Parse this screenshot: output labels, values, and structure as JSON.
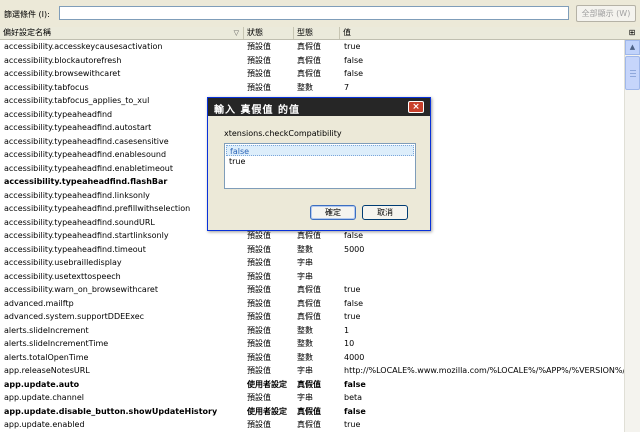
{
  "filter": {
    "label": "篩選條件 (I):",
    "value": "",
    "placeholder": "",
    "show_all_label": "全部顯示 (W)"
  },
  "columns": {
    "name": "偏好設定名稱",
    "status": "狀態",
    "type": "型態",
    "value": "值"
  },
  "rows": [
    {
      "name": "accessibility.accesskeycausesactivation",
      "status": "預設值",
      "type": "真假值",
      "value": "true",
      "bold": false
    },
    {
      "name": "accessibility.blockautorefresh",
      "status": "預設值",
      "type": "真假值",
      "value": "false",
      "bold": false
    },
    {
      "name": "accessibility.browsewithcaret",
      "status": "預設值",
      "type": "真假值",
      "value": "false",
      "bold": false
    },
    {
      "name": "accessibility.tabfocus",
      "status": "預設值",
      "type": "整數",
      "value": "7",
      "bold": false
    },
    {
      "name": "accessibility.tabfocus_applies_to_xul",
      "status": "",
      "type": "",
      "value": "",
      "bold": false
    },
    {
      "name": "accessibility.typeaheadfind",
      "status": "",
      "type": "",
      "value": "",
      "bold": false
    },
    {
      "name": "accessibility.typeaheadfind.autostart",
      "status": "",
      "type": "",
      "value": "",
      "bold": false
    },
    {
      "name": "accessibility.typeaheadfind.casesensitive",
      "status": "",
      "type": "",
      "value": "",
      "bold": false
    },
    {
      "name": "accessibility.typeaheadfind.enablesound",
      "status": "",
      "type": "",
      "value": "",
      "bold": false
    },
    {
      "name": "accessibility.typeaheadfind.enabletimeout",
      "status": "",
      "type": "",
      "value": "",
      "bold": false
    },
    {
      "name": "accessibility.typeaheadfind.flashBar",
      "status": "",
      "type": "",
      "value": "",
      "bold": true
    },
    {
      "name": "accessibility.typeaheadfind.linksonly",
      "status": "",
      "type": "",
      "value": "",
      "bold": false
    },
    {
      "name": "accessibility.typeaheadfind.prefillwithselection",
      "status": "",
      "type": "",
      "value": "",
      "bold": false
    },
    {
      "name": "accessibility.typeaheadfind.soundURL",
      "status": "",
      "type": "",
      "value": "",
      "bold": false
    },
    {
      "name": "accessibility.typeaheadfind.startlinksonly",
      "status": "預設值",
      "type": "真假值",
      "value": "false",
      "bold": false
    },
    {
      "name": "accessibility.typeaheadfind.timeout",
      "status": "預設值",
      "type": "整數",
      "value": "5000",
      "bold": false
    },
    {
      "name": "accessibility.usebrailledisplay",
      "status": "預設值",
      "type": "字串",
      "value": "",
      "bold": false
    },
    {
      "name": "accessibility.usetexttospeech",
      "status": "預設值",
      "type": "字串",
      "value": "",
      "bold": false
    },
    {
      "name": "accessibility.warn_on_browsewithcaret",
      "status": "預設值",
      "type": "真假值",
      "value": "true",
      "bold": false
    },
    {
      "name": "advanced.mailftp",
      "status": "預設值",
      "type": "真假值",
      "value": "false",
      "bold": false
    },
    {
      "name": "advanced.system.supportDDEExec",
      "status": "預設值",
      "type": "真假值",
      "value": "true",
      "bold": false
    },
    {
      "name": "alerts.slideIncrement",
      "status": "預設值",
      "type": "整數",
      "value": "1",
      "bold": false
    },
    {
      "name": "alerts.slideIncrementTime",
      "status": "預設值",
      "type": "整數",
      "value": "10",
      "bold": false
    },
    {
      "name": "alerts.totalOpenTime",
      "status": "預設值",
      "type": "整數",
      "value": "4000",
      "bold": false
    },
    {
      "name": "app.releaseNotesURL",
      "status": "預設值",
      "type": "字串",
      "value": "http://%LOCALE%.www.mozilla.com/%LOCALE%/%APP%/%VERSION%/...",
      "bold": false
    },
    {
      "name": "app.update.auto",
      "status": "使用者設定",
      "type": "真假值",
      "value": "false",
      "bold": true
    },
    {
      "name": "app.update.channel",
      "status": "預設值",
      "type": "字串",
      "value": "beta",
      "bold": false
    },
    {
      "name": "app.update.disable_button.showUpdateHistory",
      "status": "使用者設定",
      "type": "真假值",
      "value": "false",
      "bold": true
    },
    {
      "name": "app.update.enabled",
      "status": "預設值",
      "type": "真假值",
      "value": "true",
      "bold": false
    }
  ],
  "dialog": {
    "title": "輸入 真假值 的值",
    "close": "×",
    "prompt": "xtensions.checkCompatibility",
    "options": [
      "false",
      "true"
    ],
    "ok": "確定",
    "cancel": "取消"
  }
}
